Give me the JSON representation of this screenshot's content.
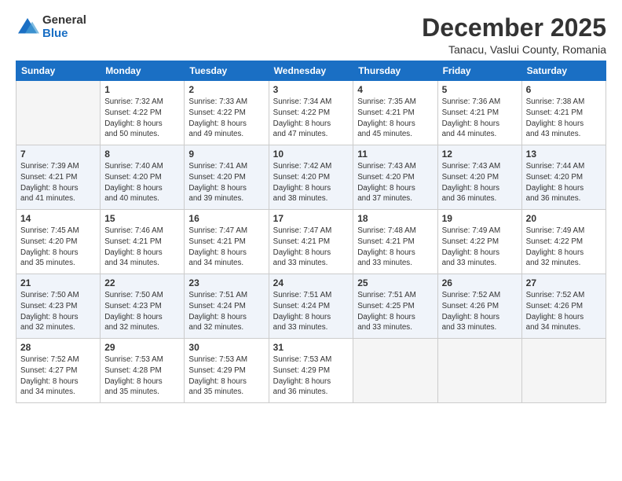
{
  "header": {
    "logo_general": "General",
    "logo_blue": "Blue",
    "month": "December 2025",
    "location": "Tanacu, Vaslui County, Romania"
  },
  "weekdays": [
    "Sunday",
    "Monday",
    "Tuesday",
    "Wednesday",
    "Thursday",
    "Friday",
    "Saturday"
  ],
  "weeks": [
    [
      {
        "day": "",
        "info": ""
      },
      {
        "day": "1",
        "info": "Sunrise: 7:32 AM\nSunset: 4:22 PM\nDaylight: 8 hours\nand 50 minutes."
      },
      {
        "day": "2",
        "info": "Sunrise: 7:33 AM\nSunset: 4:22 PM\nDaylight: 8 hours\nand 49 minutes."
      },
      {
        "day": "3",
        "info": "Sunrise: 7:34 AM\nSunset: 4:22 PM\nDaylight: 8 hours\nand 47 minutes."
      },
      {
        "day": "4",
        "info": "Sunrise: 7:35 AM\nSunset: 4:21 PM\nDaylight: 8 hours\nand 45 minutes."
      },
      {
        "day": "5",
        "info": "Sunrise: 7:36 AM\nSunset: 4:21 PM\nDaylight: 8 hours\nand 44 minutes."
      },
      {
        "day": "6",
        "info": "Sunrise: 7:38 AM\nSunset: 4:21 PM\nDaylight: 8 hours\nand 43 minutes."
      }
    ],
    [
      {
        "day": "7",
        "info": "Sunrise: 7:39 AM\nSunset: 4:21 PM\nDaylight: 8 hours\nand 41 minutes."
      },
      {
        "day": "8",
        "info": "Sunrise: 7:40 AM\nSunset: 4:20 PM\nDaylight: 8 hours\nand 40 minutes."
      },
      {
        "day": "9",
        "info": "Sunrise: 7:41 AM\nSunset: 4:20 PM\nDaylight: 8 hours\nand 39 minutes."
      },
      {
        "day": "10",
        "info": "Sunrise: 7:42 AM\nSunset: 4:20 PM\nDaylight: 8 hours\nand 38 minutes."
      },
      {
        "day": "11",
        "info": "Sunrise: 7:43 AM\nSunset: 4:20 PM\nDaylight: 8 hours\nand 37 minutes."
      },
      {
        "day": "12",
        "info": "Sunrise: 7:43 AM\nSunset: 4:20 PM\nDaylight: 8 hours\nand 36 minutes."
      },
      {
        "day": "13",
        "info": "Sunrise: 7:44 AM\nSunset: 4:20 PM\nDaylight: 8 hours\nand 36 minutes."
      }
    ],
    [
      {
        "day": "14",
        "info": "Sunrise: 7:45 AM\nSunset: 4:20 PM\nDaylight: 8 hours\nand 35 minutes."
      },
      {
        "day": "15",
        "info": "Sunrise: 7:46 AM\nSunset: 4:21 PM\nDaylight: 8 hours\nand 34 minutes."
      },
      {
        "day": "16",
        "info": "Sunrise: 7:47 AM\nSunset: 4:21 PM\nDaylight: 8 hours\nand 34 minutes."
      },
      {
        "day": "17",
        "info": "Sunrise: 7:47 AM\nSunset: 4:21 PM\nDaylight: 8 hours\nand 33 minutes."
      },
      {
        "day": "18",
        "info": "Sunrise: 7:48 AM\nSunset: 4:21 PM\nDaylight: 8 hours\nand 33 minutes."
      },
      {
        "day": "19",
        "info": "Sunrise: 7:49 AM\nSunset: 4:22 PM\nDaylight: 8 hours\nand 33 minutes."
      },
      {
        "day": "20",
        "info": "Sunrise: 7:49 AM\nSunset: 4:22 PM\nDaylight: 8 hours\nand 32 minutes."
      }
    ],
    [
      {
        "day": "21",
        "info": "Sunrise: 7:50 AM\nSunset: 4:23 PM\nDaylight: 8 hours\nand 32 minutes."
      },
      {
        "day": "22",
        "info": "Sunrise: 7:50 AM\nSunset: 4:23 PM\nDaylight: 8 hours\nand 32 minutes."
      },
      {
        "day": "23",
        "info": "Sunrise: 7:51 AM\nSunset: 4:24 PM\nDaylight: 8 hours\nand 32 minutes."
      },
      {
        "day": "24",
        "info": "Sunrise: 7:51 AM\nSunset: 4:24 PM\nDaylight: 8 hours\nand 33 minutes."
      },
      {
        "day": "25",
        "info": "Sunrise: 7:51 AM\nSunset: 4:25 PM\nDaylight: 8 hours\nand 33 minutes."
      },
      {
        "day": "26",
        "info": "Sunrise: 7:52 AM\nSunset: 4:26 PM\nDaylight: 8 hours\nand 33 minutes."
      },
      {
        "day": "27",
        "info": "Sunrise: 7:52 AM\nSunset: 4:26 PM\nDaylight: 8 hours\nand 34 minutes."
      }
    ],
    [
      {
        "day": "28",
        "info": "Sunrise: 7:52 AM\nSunset: 4:27 PM\nDaylight: 8 hours\nand 34 minutes."
      },
      {
        "day": "29",
        "info": "Sunrise: 7:53 AM\nSunset: 4:28 PM\nDaylight: 8 hours\nand 35 minutes."
      },
      {
        "day": "30",
        "info": "Sunrise: 7:53 AM\nSunset: 4:29 PM\nDaylight: 8 hours\nand 35 minutes."
      },
      {
        "day": "31",
        "info": "Sunrise: 7:53 AM\nSunset: 4:29 PM\nDaylight: 8 hours\nand 36 minutes."
      },
      {
        "day": "",
        "info": ""
      },
      {
        "day": "",
        "info": ""
      },
      {
        "day": "",
        "info": ""
      }
    ]
  ]
}
